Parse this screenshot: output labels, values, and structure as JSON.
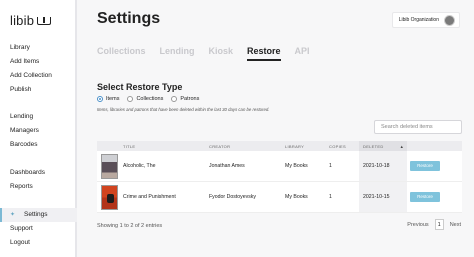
{
  "app": {
    "logo": "libib"
  },
  "sidebar": {
    "group1": [
      {
        "label": "Library"
      },
      {
        "label": "Add Items"
      },
      {
        "label": "Add Collection"
      },
      {
        "label": "Publish"
      }
    ],
    "group2": [
      {
        "label": "Lending"
      },
      {
        "label": "Managers"
      },
      {
        "label": "Barcodes"
      }
    ],
    "group3": [
      {
        "label": "Dashboards"
      },
      {
        "label": "Reports"
      }
    ],
    "group4": [
      {
        "label": "Settings",
        "icon": "gear-icon",
        "active": true
      },
      {
        "label": "Support"
      },
      {
        "label": "Logout"
      }
    ]
  },
  "header": {
    "title": "Settings",
    "organization": "Libib Organization"
  },
  "tabs": [
    {
      "label": "Collections"
    },
    {
      "label": "Lending"
    },
    {
      "label": "Kiosk"
    },
    {
      "label": "Restore",
      "active": true
    },
    {
      "label": "API"
    }
  ],
  "restore": {
    "title": "Select Restore Type",
    "options": [
      {
        "label": "Items",
        "selected": true
      },
      {
        "label": "Collections",
        "selected": false
      },
      {
        "label": "Patrons",
        "selected": false
      }
    ],
    "note": "Items, libraries and patrons that have been deleted within the last 30 days can be restored.",
    "search_placeholder": "Search deleted items"
  },
  "table": {
    "columns": [
      "TITLE",
      "CREATOR",
      "LIBRARY",
      "COPIES",
      "DELETED"
    ],
    "rows": [
      {
        "title": "Alcoholic, The",
        "creator": "Jonathan Ames",
        "library": "My Books",
        "copies": "1",
        "deleted": "2021-10-18",
        "action": "Restore"
      },
      {
        "title": "Crime and Punishment",
        "creator": "Fyodor Dostoyevsky",
        "library": "My Books",
        "copies": "1",
        "deleted": "2021-10-15",
        "action": "Restore"
      }
    ]
  },
  "pagination": {
    "info": "Showing 1 to 2 of 2 entries",
    "previous": "Previous",
    "page": "1",
    "next": "Next"
  },
  "colors": {
    "accent": "#7fc3dc",
    "active_border": "#7cb9d4"
  }
}
